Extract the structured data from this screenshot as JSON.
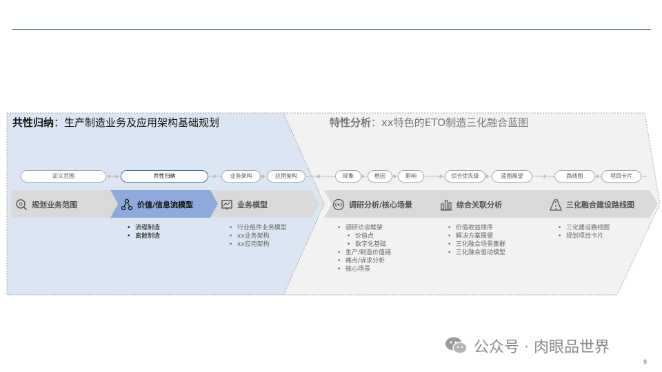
{
  "left_section": {
    "title_bold": "共性归纳",
    "title_rest": "：生产制造业务及应用架构基础规划"
  },
  "right_section": {
    "title_bold": "特性分析",
    "title_rest": "：xx特色的ETO制造三化融合蓝图"
  },
  "pills": [
    "定义范围",
    "共性归纳",
    "业务架构",
    "应用架构",
    "现象",
    "根因",
    "影响",
    "综合优先级",
    "蓝图展望",
    "路线图",
    "项目卡片"
  ],
  "stages": [
    {
      "label": "规划业务范围",
      "icon": "search-gear-icon"
    },
    {
      "label": "价值/信息流模型",
      "icon": "network-icon"
    },
    {
      "label": "业务模型",
      "icon": "chart-board-icon"
    },
    {
      "label": "调研分析/核心场景",
      "icon": "broadcast-icon"
    },
    {
      "label": "综合关联分析",
      "icon": "bar-chart-icon"
    },
    {
      "label": "三化融合建设路线图",
      "icon": "road-icon"
    }
  ],
  "lists": {
    "value_flow": [
      "流程制造",
      "离散制造"
    ],
    "business_model": [
      "行业组件业务模型",
      "xx业务架构",
      "xx应用架构"
    ],
    "research": {
      "a": "调研访谈框架",
      "a_sub": [
        "价值点",
        "数字化基础"
      ],
      "rest": [
        "生产/制造价值链",
        "痛点/诉求分析",
        "核心场景"
      ]
    },
    "correlation": [
      "价值收益排序",
      "解决方案展望",
      "三化融合场景集群",
      "三化融合驱动模型"
    ],
    "roadmap": [
      "三化建设路线图",
      "规划项目卡片"
    ]
  },
  "colors": {
    "left_bg": "#dce6f2",
    "active_arrow": "#8eaadb",
    "arrow": "#d9d9d9",
    "right_bg": "#f2f2f2",
    "rule": "#2f4a44"
  },
  "watermark": "公众号 · 肉眼品世界",
  "page_number": "9"
}
